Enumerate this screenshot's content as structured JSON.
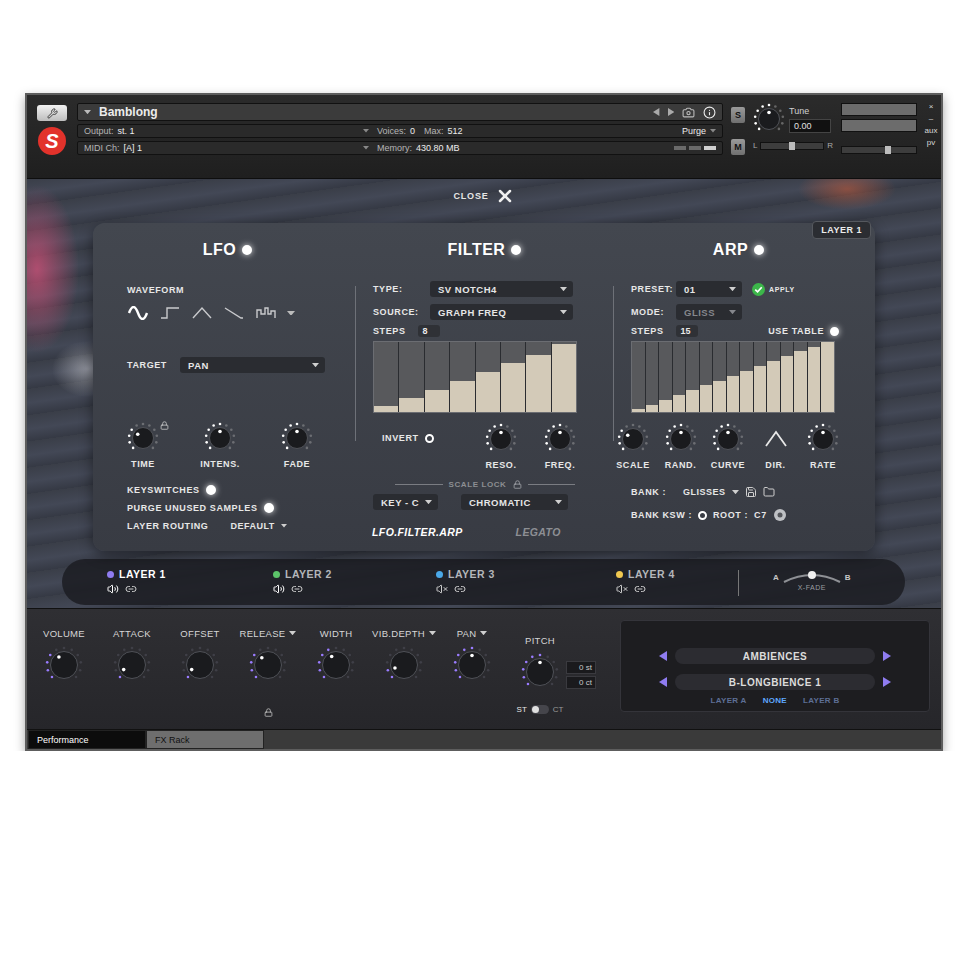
{
  "window": {
    "title": "Bamblong",
    "logo": "S",
    "output_label": "Output:",
    "output": "st. 1",
    "midi_label": "MIDI Ch:",
    "midi": "[A] 1",
    "voices_label": "Voices:",
    "voices": "0",
    "max_label": "Max:",
    "max": "512",
    "memory_label": "Memory:",
    "memory": "430.80 MB",
    "purge": "Purge",
    "solo": "S",
    "mute": "M",
    "tune_label": "Tune",
    "tune": "0.00",
    "tune_level": 0.5,
    "pan_left": "L",
    "pan_right": "R",
    "pan_level": 0.5,
    "meters": [
      0,
      0
    ],
    "volume_level": 0.62,
    "close": "×",
    "minimize": "–",
    "aux": "aux",
    "pv": "pv"
  },
  "close_panel": {
    "label": "CLOSE"
  },
  "badge": "LAYER 1",
  "lfo": {
    "title": "LFO",
    "on": true,
    "waveform_label": "WAVEFORM",
    "waveforms": [
      {
        "kind": "sine",
        "selected": true
      },
      {
        "kind": "square",
        "selected": false
      },
      {
        "kind": "triangle",
        "selected": false
      },
      {
        "kind": "saw",
        "selected": false
      },
      {
        "kind": "random",
        "selected": false
      }
    ],
    "target_label": "TARGET",
    "target": "PAN",
    "knobs": [
      {
        "label": "TIME",
        "level": 0.3,
        "locked": true
      },
      {
        "label": "INTENS.",
        "level": 0.5,
        "locked": false
      },
      {
        "label": "FADE",
        "level": 0.5,
        "locked": false
      }
    ],
    "switches": [
      {
        "label": "KEYSWITCHES",
        "on": true
      },
      {
        "label": "PURGE UNUSED SAMPLES",
        "on": true
      }
    ],
    "routing_label": "LAYER ROUTING",
    "routing": "DEFAULT"
  },
  "filter": {
    "title": "FILTER",
    "on": true,
    "type_label": "TYPE:",
    "type": "SV NOTCH4",
    "source_label": "SOURCE:",
    "source": "GRAPH FREQ",
    "steps_label": "STEPS",
    "steps": "8",
    "graph": [
      0.08,
      0.2,
      0.32,
      0.45,
      0.57,
      0.7,
      0.82,
      0.97
    ],
    "invert_label": "INVERT",
    "invert": false,
    "knobs": [
      {
        "label": "RESO.",
        "level": 0.5
      },
      {
        "label": "FREQ.",
        "level": 0.5
      }
    ],
    "scale_lock_label": "SCALE LOCK",
    "key": "KEY - C",
    "scale": "CHROMATIC"
  },
  "arp": {
    "title": "ARP",
    "on": true,
    "preset_label": "PRESET:",
    "preset": "01",
    "apply": "APPLY",
    "mode_label": "MODE:",
    "mode": "GLISS",
    "mode_disabled": true,
    "steps_label": "STEPS",
    "steps": "15",
    "use_table_label": "USE TABLE",
    "use_table": true,
    "graph": [
      0.04,
      0.1,
      0.17,
      0.24,
      0.31,
      0.38,
      0.45,
      0.52,
      0.59,
      0.66,
      0.73,
      0.8,
      0.87,
      0.93,
      1.0
    ],
    "controls": [
      {
        "kind": "knob",
        "label": "SCALE",
        "level": 0.3
      },
      {
        "kind": "knob",
        "label": "RAND.",
        "level": 0.5
      },
      {
        "kind": "knob",
        "label": "CURVE",
        "level": 0.5
      },
      {
        "kind": "direction",
        "label": "DIR.",
        "level": 0
      },
      {
        "kind": "knob",
        "label": "RATE",
        "level": 0.5
      }
    ],
    "bank_label": "BANK :",
    "bank": "GLISSES",
    "bank_ksw_label": "BANK KSW :",
    "bank_ksw": false,
    "root_label": "ROOT :",
    "root": "C7"
  },
  "page_tabs": [
    {
      "label": "LFO.FILTER.ARP",
      "selected": true
    },
    {
      "label": "LEGATO",
      "selected": false
    }
  ],
  "layers": [
    {
      "label": "LAYER 1",
      "color": "#8f7cf0",
      "selected": true,
      "muted": false
    },
    {
      "label": "LAYER 2",
      "color": "#5cc46a",
      "selected": false,
      "muted": false
    },
    {
      "label": "LAYER 3",
      "color": "#4aa8e8",
      "selected": false,
      "muted": true
    },
    {
      "label": "LAYER 4",
      "color": "#f0c850",
      "selected": false,
      "muted": true
    }
  ],
  "xfade": {
    "a": "A",
    "b": "B",
    "label": "X-FADE",
    "level": 0.5
  },
  "controls": [
    {
      "kind": "knob",
      "label": "VOLUME",
      "level": 0.38,
      "menu": false,
      "locked": false
    },
    {
      "kind": "knob",
      "label": "ATTACK",
      "level": 0.06,
      "menu": false,
      "locked": false
    },
    {
      "kind": "knob",
      "label": "OFFSET",
      "level": 0.06,
      "menu": false,
      "locked": false
    },
    {
      "kind": "knob",
      "label": "RELEASE",
      "level": 0.35,
      "menu": true,
      "locked": true
    },
    {
      "kind": "knob",
      "label": "WIDTH",
      "level": 0.4,
      "menu": false,
      "locked": false
    },
    {
      "kind": "knob",
      "label": "VIB.DEPTH",
      "level": 0.1,
      "menu": true,
      "locked": false
    },
    {
      "kind": "knob",
      "label": "PAN",
      "level": 0.5,
      "menu": true,
      "locked": false
    },
    {
      "kind": "pitch",
      "label": "PITCH",
      "level": 0.5,
      "menu": false,
      "locked": false
    }
  ],
  "pitch": {
    "semitones": "0 st",
    "cents": "0 ct",
    "switch": [
      {
        "label": "ST",
        "selected": true
      },
      {
        "label": "CT",
        "selected": false
      }
    ]
  },
  "ambience": {
    "category": "AMBIENCES",
    "preset": "B-LONGBIENCE 1",
    "targets": [
      {
        "label": "LAYER A",
        "selected": false
      },
      {
        "label": "NONE",
        "selected": true
      },
      {
        "label": "LAYER B",
        "selected": false
      }
    ]
  },
  "bottom_tabs": [
    {
      "label": "Performance",
      "selected": true
    },
    {
      "label": "FX Rack",
      "selected": false
    }
  ]
}
